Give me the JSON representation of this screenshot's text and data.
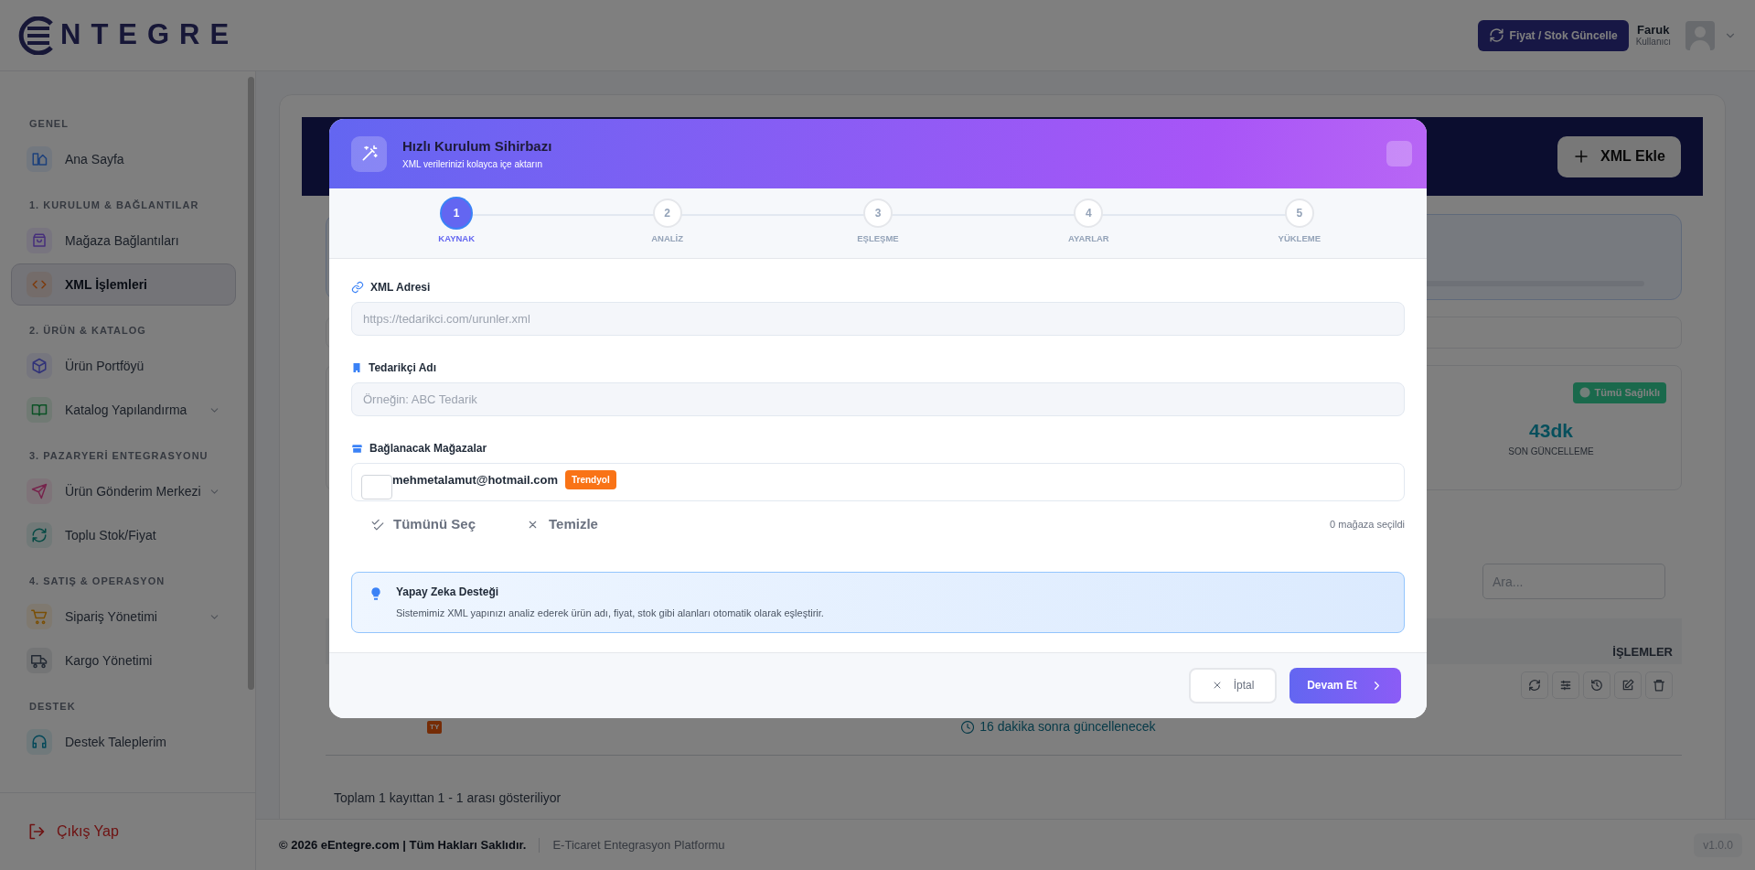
{
  "header": {
    "logo": "NTEGRE",
    "update_button": "Fiyat / Stok Güncelle",
    "user": {
      "name": "Faruk",
      "role": "Kullanıcı"
    }
  },
  "sidebar": {
    "sections": [
      {
        "title": "GENEL",
        "items": [
          {
            "label": "Ana Sayfa",
            "active": false,
            "expandable": false
          }
        ]
      },
      {
        "title": "1. KURULUM & BAĞLANTILAR",
        "items": [
          {
            "label": "Mağaza Bağlantıları",
            "active": false,
            "expandable": false
          },
          {
            "label": "XML İşlemleri",
            "active": true,
            "expandable": false
          }
        ]
      },
      {
        "title": "2. ÜRÜN & KATALOG",
        "items": [
          {
            "label": "Ürün Portföyü",
            "active": false,
            "expandable": false
          },
          {
            "label": "Katalog Yapılandırma",
            "active": false,
            "expandable": true
          }
        ]
      },
      {
        "title": "3. PAZARYERİ ENTEGRASYONU",
        "items": [
          {
            "label": "Ürün Gönderim Merkezi",
            "active": false,
            "expandable": true
          },
          {
            "label": "Toplu Stok/Fiyat",
            "active": false,
            "expandable": false
          }
        ]
      },
      {
        "title": "4. SATIŞ & OPERASYON",
        "items": [
          {
            "label": "Sipariş Yönetimi",
            "active": false,
            "expandable": true
          },
          {
            "label": "Kargo Yönetimi",
            "active": false,
            "expandable": false
          }
        ]
      },
      {
        "title": "DESTEK",
        "items": [
          {
            "label": "Destek Taleplerim",
            "active": false,
            "expandable": false
          }
        ]
      }
    ],
    "logout": "Çıkış Yap"
  },
  "page": {
    "add_button": "XML Ekle",
    "status_badge": "Tümü Sağlıklı",
    "stat": {
      "value": "43dk",
      "label": "SON GÜNCELLEME"
    },
    "search": {
      "placeholder": "Ara..."
    },
    "table": {
      "column_header": "İŞLEMLER",
      "row": {
        "tag": "TY",
        "schedule": "16 dakika sonra güncellenecek"
      }
    },
    "summary": "Toplam 1 kayıttan 1 - 1 arası gösteriliyor"
  },
  "footer": {
    "copyright": "© 2026 eEntegre.com | Tüm Hakları Saklıdır.",
    "tagline": "E-Ticaret Entegrasyon Platformu",
    "version": "v1.0.0"
  },
  "modal": {
    "title": "Hızlı Kurulum Sihirbazı",
    "subtitle": "XML verilerinizi kolayca içe aktarın",
    "steps": [
      {
        "number": "1",
        "label": "KAYNAK",
        "selected": true
      },
      {
        "number": "2",
        "label": "ANALİZ",
        "selected": false
      },
      {
        "number": "3",
        "label": "EŞLEŞME",
        "selected": false
      },
      {
        "number": "4",
        "label": "AYARLAR",
        "selected": false
      },
      {
        "number": "5",
        "label": "YÜKLEME",
        "selected": false
      }
    ],
    "fields": [
      {
        "label": "XML Adresi",
        "placeholder": "https://tedarikci.com/urunler.xml"
      },
      {
        "label": "Tedarikçi Adı",
        "placeholder": "Örneğin: ABC Tedarik"
      }
    ],
    "stores_label": "Bağlanacak Mağazalar",
    "stores": [
      {
        "name": "mehmetalamut@hotmail.com",
        "badge": "Trendyol",
        "checked": false
      }
    ],
    "select_all": "Tümünü Seç",
    "clear": "Temizle",
    "selected_count": "0 mağaza seçildi",
    "info": {
      "title": "Yapay Zeka Desteği",
      "text": "Sistemimiz XML yapınızı analiz ederek ürün adı, fiyat, stok gibi alanları otomatik olarak eşleştirir."
    },
    "cancel": "İptal",
    "continue": "Devam Et"
  }
}
